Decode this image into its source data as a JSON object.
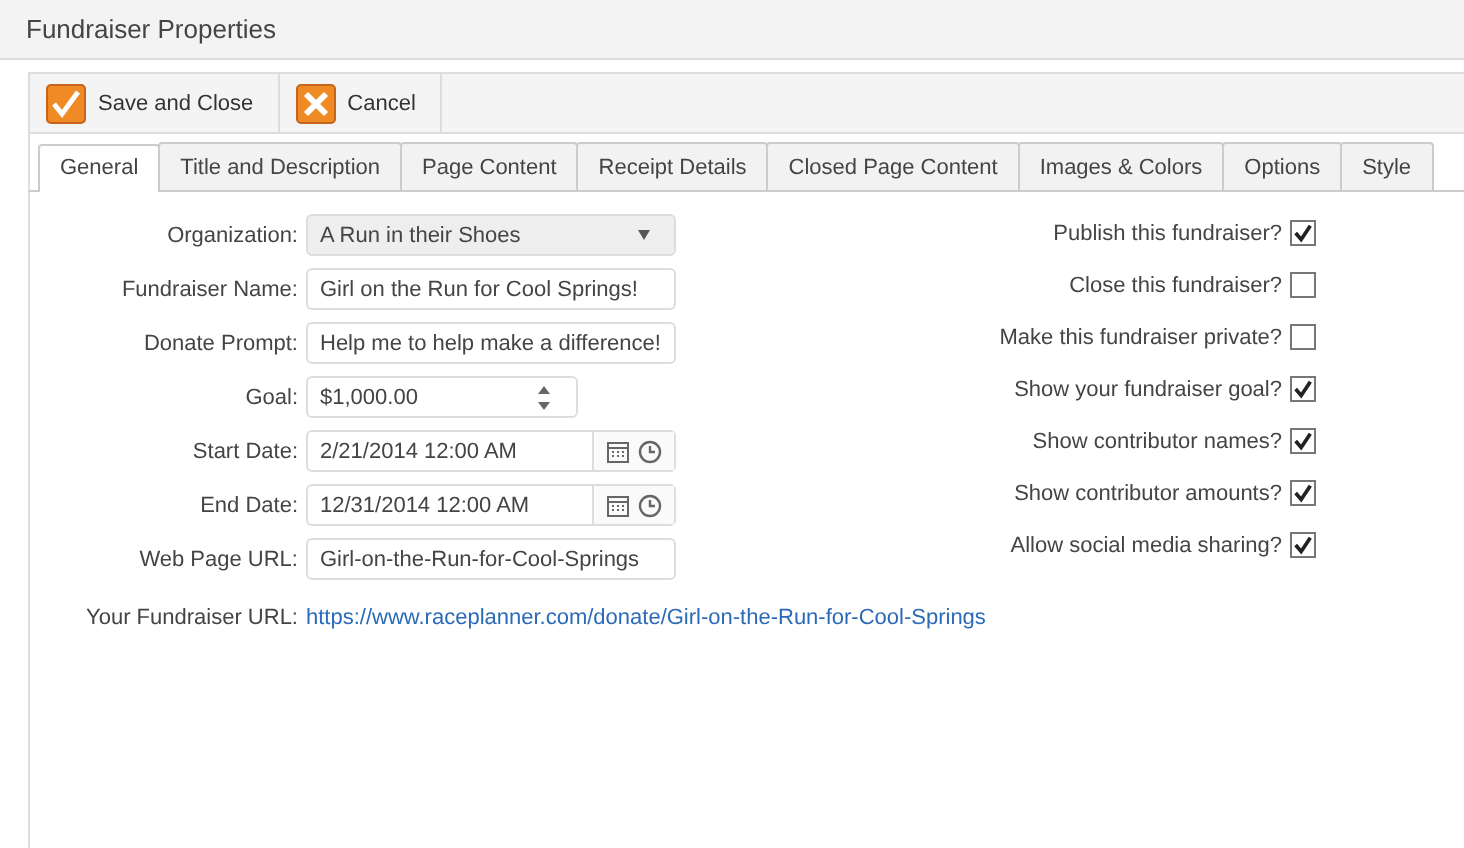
{
  "window": {
    "title": "Fundraiser Properties"
  },
  "toolbar": [
    {
      "kind": "save",
      "label": "Save and Close"
    },
    {
      "kind": "cancel",
      "label": "Cancel"
    }
  ],
  "tabs": [
    {
      "label": "General",
      "selected": true
    },
    {
      "label": "Title and Description",
      "selected": false
    },
    {
      "label": "Page Content",
      "selected": false
    },
    {
      "label": "Receipt Details",
      "selected": false
    },
    {
      "label": "Closed Page Content",
      "selected": false
    },
    {
      "label": "Images & Colors",
      "selected": false
    },
    {
      "label": "Options",
      "selected": false
    },
    {
      "label": "Style",
      "selected": false
    }
  ],
  "fields": [
    {
      "kind": "select",
      "label": "Organization:",
      "value": "A Run in their Shoes"
    },
    {
      "kind": "text",
      "label": "Fundraiser Name:",
      "value": "Girl on the Run for Cool Springs!"
    },
    {
      "kind": "text",
      "label": "Donate Prompt:",
      "value": "Help me to help make a difference!"
    },
    {
      "kind": "spinner",
      "label": "Goal:",
      "value": "$1,000.00"
    },
    {
      "kind": "datetime",
      "label": "Start Date:",
      "value": "2/21/2014 12:00 AM"
    },
    {
      "kind": "datetime",
      "label": "End Date:",
      "value": "12/31/2014 12:00 AM"
    },
    {
      "kind": "text",
      "label": "Web Page URL:",
      "value": "Girl-on-the-Run-for-Cool-Springs"
    }
  ],
  "fundraiser_url": {
    "label": "Your Fundraiser URL:",
    "link": "https://www.raceplanner.com/donate/Girl-on-the-Run-for-Cool-Springs"
  },
  "options": [
    {
      "label": "Publish this fundraiser?",
      "checked": true
    },
    {
      "label": "Close this fundraiser?",
      "checked": false
    },
    {
      "label": "Make this fundraiser private?",
      "checked": false
    },
    {
      "label": "Show your fundraiser goal?",
      "checked": true
    },
    {
      "label": "Show contributor names?",
      "checked": true
    },
    {
      "label": "Show contributor amounts?",
      "checked": true
    },
    {
      "label": "Allow social media sharing?",
      "checked": true
    }
  ]
}
